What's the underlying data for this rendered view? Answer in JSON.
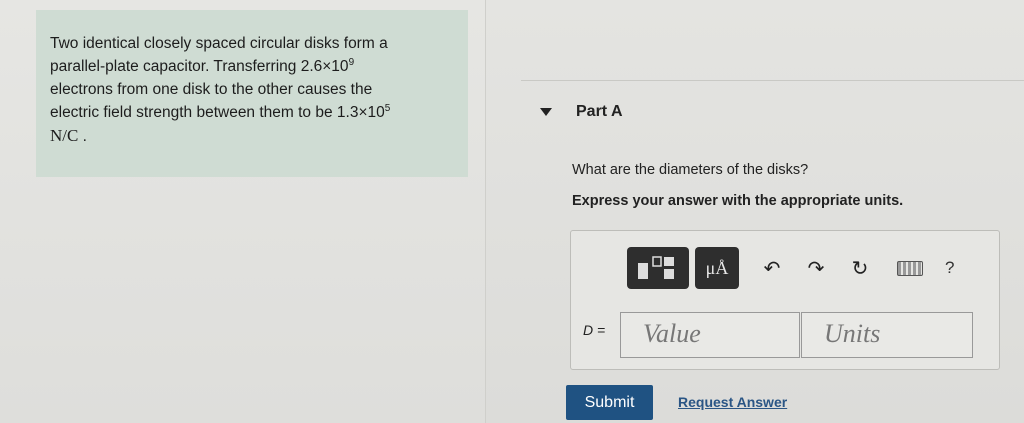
{
  "problem": {
    "line1": "Two identical closely spaced circular disks form a",
    "line2_pre": "parallel-plate capacitor. Transferring 2.6×10",
    "line2_exp": "9",
    "line3": "electrons from one disk to the other causes the",
    "line4_pre": "electric field strength between them to be 1.3×10",
    "line4_exp": "5",
    "unit": "N/C",
    "unit_suffix": "."
  },
  "part": {
    "label": "Part A",
    "question": "What are the diameters of the disks?",
    "instruction": "Express your answer with the appropriate units."
  },
  "toolbar": {
    "units_label": "μÅ",
    "undo_icon": "undo-icon",
    "redo_icon": "redo-icon",
    "reset_icon": "reset-icon",
    "keyboard_icon": "keyboard-icon",
    "help_label": "?"
  },
  "answer": {
    "variable_label": "D =",
    "value_placeholder": "Value",
    "units_placeholder": "Units"
  },
  "actions": {
    "submit_label": "Submit",
    "request_label": "Request Answer"
  },
  "colors": {
    "problem_bg": "#cfdcd3",
    "submit_bg": "#1f5282",
    "link": "#2a5585"
  }
}
